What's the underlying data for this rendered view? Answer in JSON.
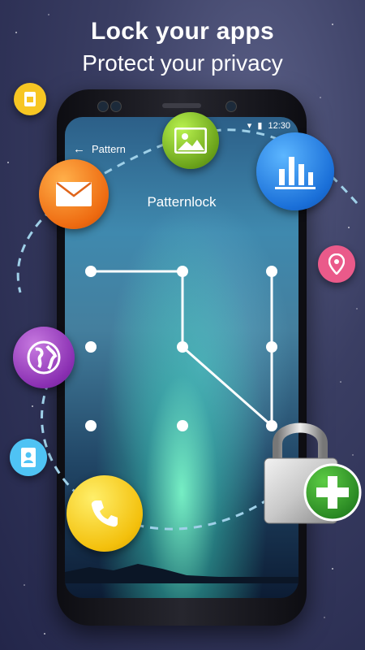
{
  "headline": {
    "title": "Lock your apps",
    "subtitle": "Protect your privacy"
  },
  "phone": {
    "status_bar": {
      "signal_icon": "signal-icon",
      "battery_icon": "battery-icon",
      "time": "12:30"
    },
    "toolbar": {
      "back_icon": "back-arrow-icon",
      "title": "Pattern"
    },
    "pattern_title": "Patternlock"
  },
  "colors": {
    "gallery": "#7cc01f",
    "chart": "#1e78e0",
    "mail": "#f07a1a",
    "globe": "#9b3cc4",
    "phone_call": "#f4c30f",
    "sim": "#f7c623",
    "location": "#ea5a8a",
    "contacts": "#4fc3f4",
    "lock_plus": "#2f9a2a",
    "dashed_path": "#9fd0e8"
  },
  "icons": [
    "sim-card-icon",
    "image-gallery-icon",
    "bar-chart-icon",
    "mail-icon",
    "location-pin-icon",
    "globe-icon",
    "contacts-icon",
    "phone-call-icon",
    "padlock-icon",
    "plus-icon"
  ]
}
